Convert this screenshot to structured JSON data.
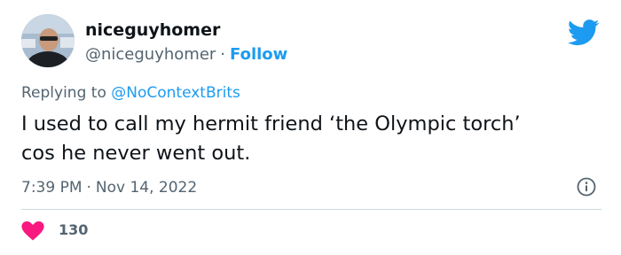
{
  "user": {
    "display_name": "niceguyhomer",
    "handle": "@niceguyhomer",
    "separator": "·",
    "follow_label": "Follow"
  },
  "reply": {
    "prefix": "Replying to",
    "mention": "@NoContextBrits"
  },
  "tweet": {
    "lines": [
      "I used to call my hermit friend ‘the Olympic torch’",
      "cos he never went out."
    ]
  },
  "meta": {
    "time": "7:39 PM",
    "separator": "·",
    "date": "Nov 14, 2022"
  },
  "engagement": {
    "likes": "130"
  },
  "icons": {
    "brand": "twitter-bird-icon",
    "info": "info-icon",
    "like": "heart-icon"
  },
  "colors": {
    "accent": "#1d9bf0",
    "like": "#f91880",
    "text": "#0f1419",
    "secondary": "#536471",
    "divider": "#cfd9de"
  }
}
